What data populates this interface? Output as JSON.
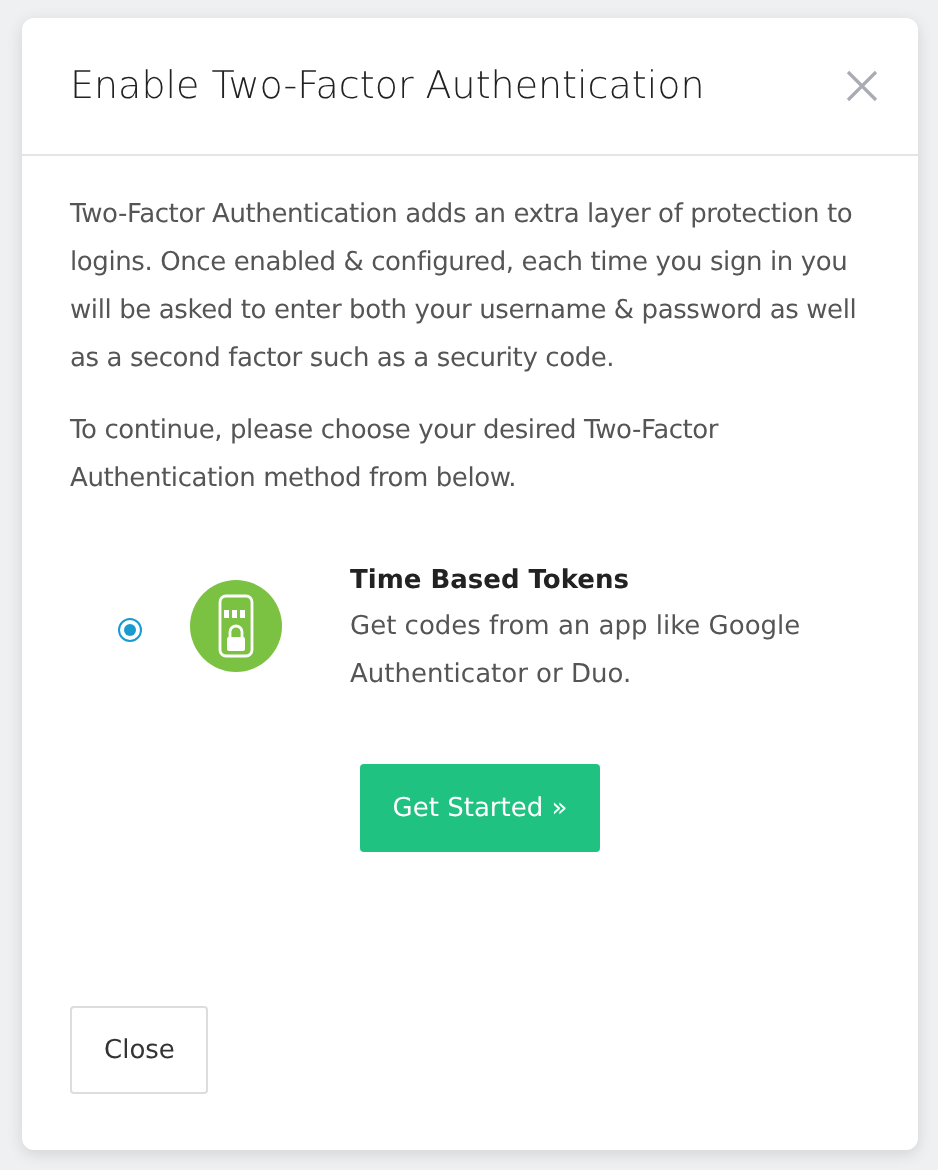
{
  "dialog": {
    "title": "Enable Two-Factor Authentication",
    "paragraphs": [
      "Two-Factor Authentication adds an extra layer of protection to logins. Once enabled & configured, each time you sign in you will be asked to enter both your username & password as well as a second factor such as a security code.",
      "To continue, please choose your desired Two-Factor Authentication method from below."
    ],
    "methods": [
      {
        "title": "Time Based Tokens",
        "description": "Get codes from an app like Google Authenticator or Duo.",
        "selected": true
      }
    ],
    "primary_button": "Get Started »",
    "footer_button": "Close"
  }
}
